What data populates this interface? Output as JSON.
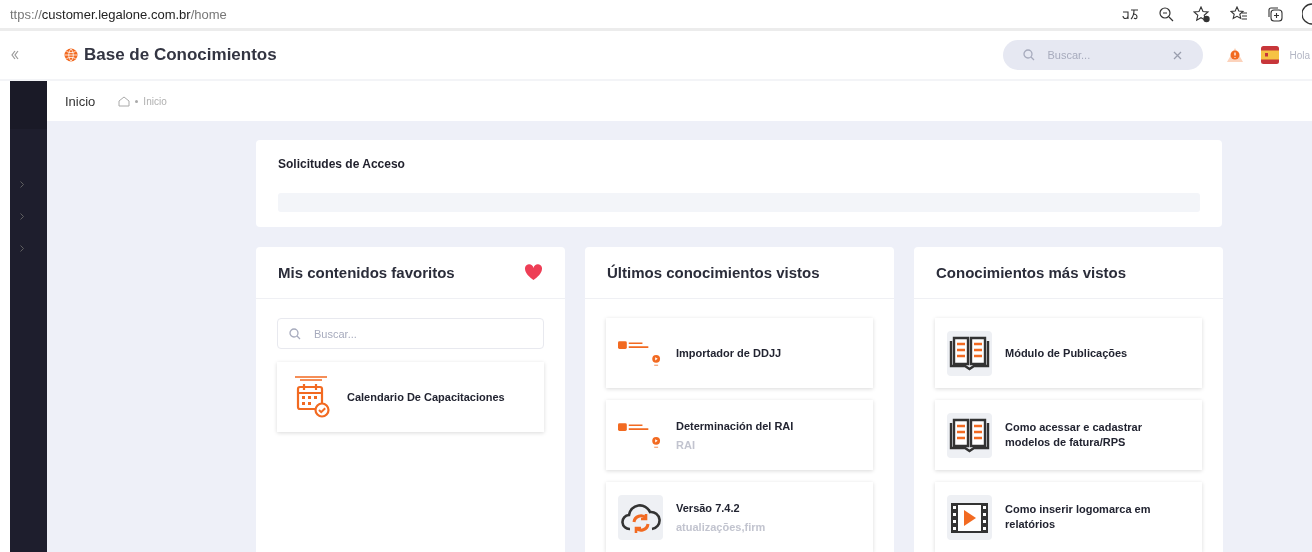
{
  "browser": {
    "url_prefix": "ttps://",
    "url_host": "customer.legalone.com.br",
    "url_path": "/home"
  },
  "header": {
    "title": "Base de Conocimientos",
    "search": {
      "placeholder": "Buscar..."
    },
    "greeting": "Hola"
  },
  "breadcrumb": {
    "page": "Inicio",
    "trail": "Inicio"
  },
  "access_requests": {
    "title": "Solicitudes de Acceso"
  },
  "columns": [
    {
      "title": "Mis contenidos favoritos",
      "favorite": true,
      "search": {
        "placeholder": "Buscar..."
      },
      "items": [
        {
          "kind": "calendar",
          "title": "Calendario De Capacitaciones"
        }
      ]
    },
    {
      "title": "Últimos conocimientos vistos",
      "favorite": false,
      "items": [
        {
          "kind": "hyperrenta",
          "title": "Importador de DDJJ"
        },
        {
          "kind": "hyperrenta",
          "title": "Determinación del RAI",
          "subtitle": "RAI"
        },
        {
          "kind": "cloud",
          "title": "Versão 7.4.2",
          "subtitle": "atualizações,firm"
        }
      ]
    },
    {
      "title": "Conocimientos más vistos",
      "favorite": false,
      "items": [
        {
          "kind": "book",
          "title": "Módulo de Publicações"
        },
        {
          "kind": "book",
          "title": "Como acessar e cadastrar modelos de fatura/RPS"
        },
        {
          "kind": "film",
          "title": "Como inserir logomarca em relatórios"
        }
      ]
    }
  ]
}
